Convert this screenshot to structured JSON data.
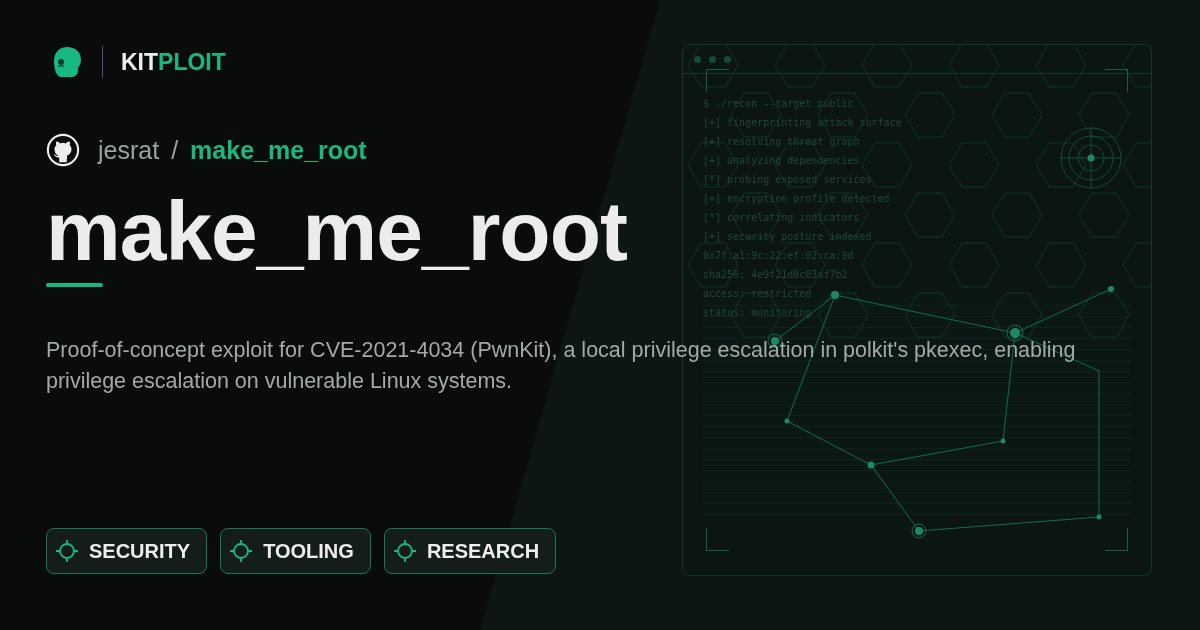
{
  "brand": {
    "part_1": "KIT",
    "part_2": "PLOIT"
  },
  "repo": {
    "owner": "jesrat",
    "separator": "/",
    "name": "make_me_root"
  },
  "title": "make_me_root",
  "description": "Proof-of-concept exploit for CVE-2021-4034 (PwnKit), a local privilege escalation in polkit's pkexec, enabling privilege escalation on vulnerable Linux systems.",
  "tags": [
    "SECURITY",
    "TOOLING",
    "RESEARCH"
  ],
  "terminal": {
    "lines": [
      "$ ./recon --target public",
      "[+] fingerprinting attack surface",
      "[+] resolving threat graph",
      "[+] analyzing dependencies",
      "[*] probing exposed services",
      "[+] encryption profile detected",
      "[*] correlating indicators",
      "[+] security posture indexed",
      "0x7f:a1:9c:22:ef:02:ca:9d",
      "sha256: 4e9f21d8c03af7b2",
      "access: restricted",
      "status: monitoring"
    ]
  }
}
